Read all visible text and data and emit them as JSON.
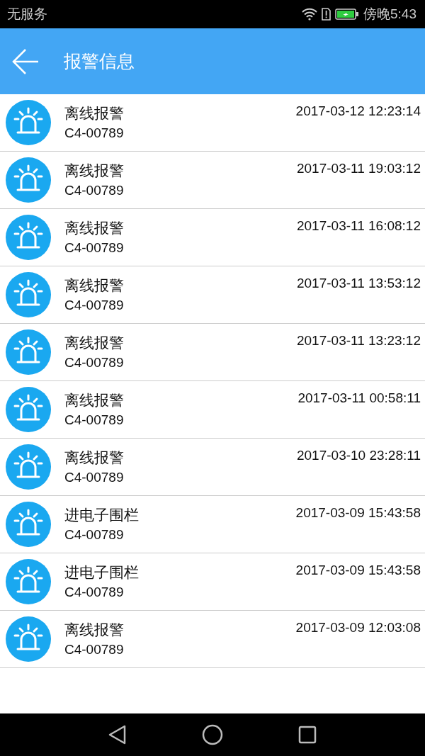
{
  "status_bar": {
    "carrier": "无服务",
    "time": "傍晚5:43"
  },
  "app_bar": {
    "title": "报警信息"
  },
  "alarms": [
    {
      "title": "离线报警",
      "device": "C4-00789",
      "time": "2017-03-12 12:23:14"
    },
    {
      "title": "离线报警",
      "device": "C4-00789",
      "time": "2017-03-11 19:03:12"
    },
    {
      "title": "离线报警",
      "device": "C4-00789",
      "time": "2017-03-11 16:08:12"
    },
    {
      "title": "离线报警",
      "device": "C4-00789",
      "time": "2017-03-11 13:53:12"
    },
    {
      "title": "离线报警",
      "device": "C4-00789",
      "time": "2017-03-11 13:23:12"
    },
    {
      "title": "离线报警",
      "device": "C4-00789",
      "time": "2017-03-11 00:58:11"
    },
    {
      "title": "离线报警",
      "device": "C4-00789",
      "time": "2017-03-10 23:28:11"
    },
    {
      "title": "进电子围栏",
      "device": "C4-00789",
      "time": "2017-03-09 15:43:58"
    },
    {
      "title": "进电子围栏",
      "device": "C4-00789",
      "time": "2017-03-09 15:43:58"
    },
    {
      "title": "离线报警",
      "device": "C4-00789",
      "time": "2017-03-09 12:03:08"
    }
  ]
}
